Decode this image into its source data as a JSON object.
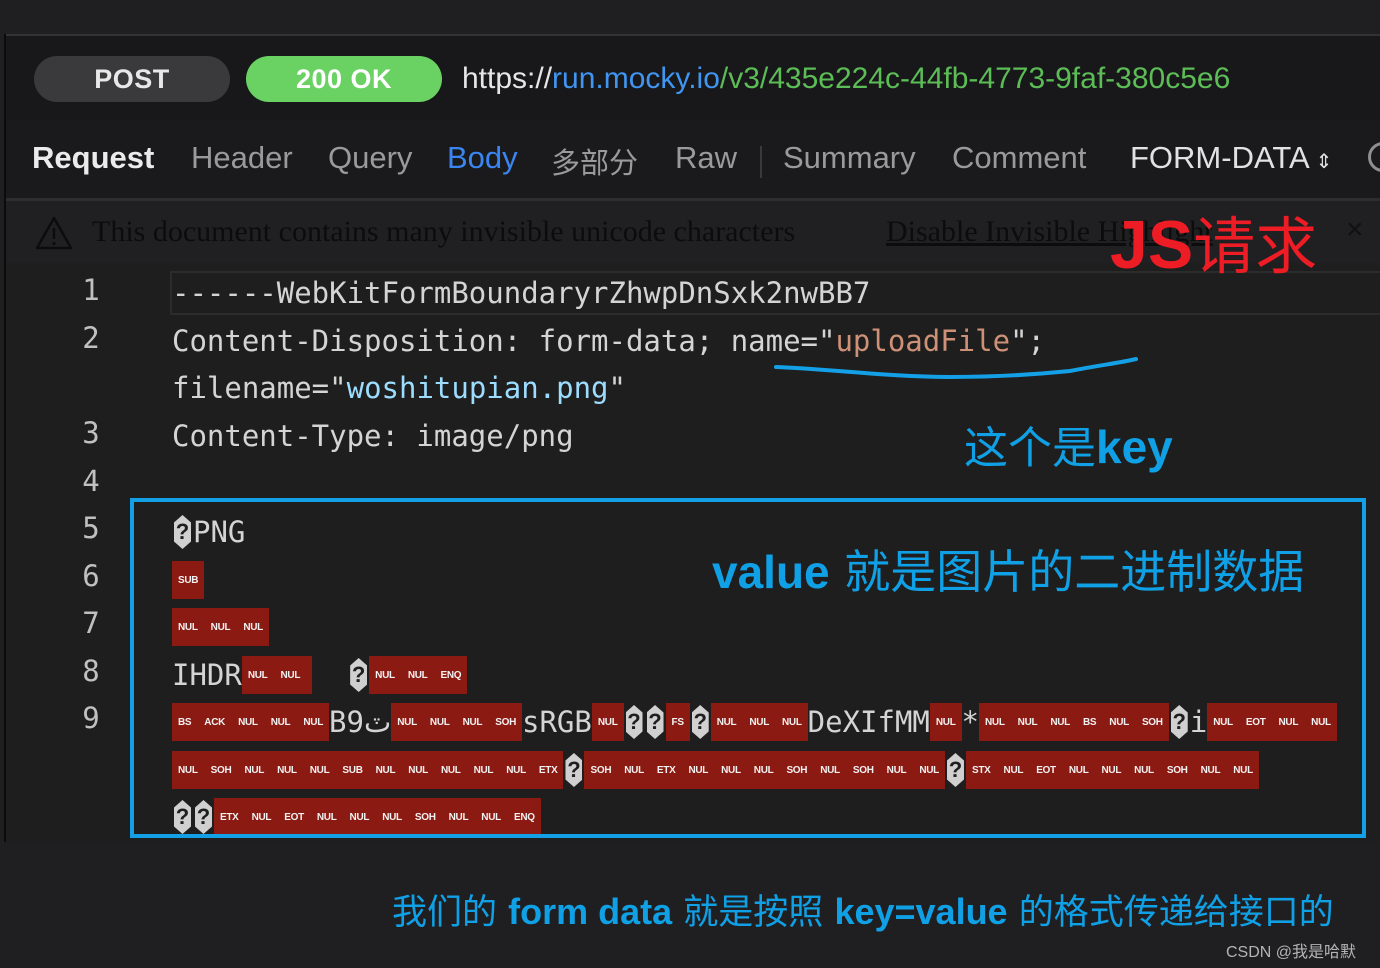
{
  "request_bar": {
    "method": "POST",
    "status": "200 OK",
    "url": {
      "scheme": "https://",
      "host": "run.mocky.io",
      "path": "/v3/435e224c-44fb-4773-9faf-380c5e6"
    },
    "colors": {
      "status_bg": "#6ad163",
      "host": "#3f95f0",
      "path": "#5cbd56"
    }
  },
  "tabs": {
    "title": "Request",
    "items": [
      "Header",
      "Query",
      "Body",
      "多部分",
      "Raw",
      "Summary",
      "Comment"
    ],
    "active": "Body",
    "format_select": "FORM-DATA",
    "format_icon": "up-down-chevron-icon",
    "more_icon": "more-icon"
  },
  "warning": {
    "icon": "warning-triangle-icon",
    "message": "This document contains many invisible unicode characters",
    "action": "Disable Invisible Highlight",
    "close": "×"
  },
  "editor": {
    "line_numbers": [
      "1",
      "2",
      "",
      "3",
      "4",
      "5",
      "6",
      "7",
      "8",
      "9"
    ],
    "line1": "------WebKitFormBoundaryrZhwpDnSxk2nwBB7",
    "line2_prefix": "Content-Disposition: form-data; name=\"",
    "line2_name": "uploadFile",
    "line2_suffix": "\";",
    "line2b_prefix": "filename=\"",
    "line2b_filename": "woshitupian.png",
    "line2b_suffix": "\"",
    "line3": "Content-Type: image/png",
    "line5_text": "PNG",
    "line6_ctrl": [
      "SUB"
    ],
    "line7_ctrl": [
      "NUL",
      "NUL",
      "NUL"
    ],
    "line8": {
      "text": "IHDR",
      "ctrl_a": [
        "NUL",
        "NUL"
      ],
      "ctrl_b": [
        "NUL",
        "NUL",
        "ENQ"
      ]
    },
    "line9": {
      "ctrl_1": [
        "BS",
        "ACK",
        "NUL",
        "NUL",
        "NUL"
      ],
      "text_1": "B9ٽ",
      "ctrl_2": [
        "NUL",
        "NUL",
        "NUL",
        "SOH"
      ],
      "text_2": "sRGB",
      "ctrl_3": [
        "NUL"
      ],
      "ctrl_4": [
        "FS"
      ],
      "ctrl_5": [
        "NUL",
        "NUL",
        "NUL"
      ],
      "text_3": "DeXIfMM",
      "ctrl_6": [
        "NUL"
      ],
      "text_4": "*",
      "ctrl_7": [
        "NUL",
        "NUL",
        "NUL",
        "BS",
        "NUL",
        "SOH"
      ],
      "text_5": "i",
      "ctrl_8": [
        "NUL",
        "EOT",
        "NUL",
        "NUL"
      ]
    },
    "line9_wrap1": {
      "ctrl_1": [
        "NUL",
        "SOH",
        "NUL",
        "NUL",
        "NUL",
        "SUB",
        "NUL",
        "NUL",
        "NUL",
        "NUL",
        "NUL",
        "ETX"
      ],
      "ctrl_2": [
        "SOH",
        "NUL",
        "ETX",
        "NUL",
        "NUL",
        "NUL",
        "SOH",
        "NUL",
        "SOH",
        "NUL",
        "NUL"
      ],
      "ctrl_3": [
        "STX",
        "NUL",
        "EOT",
        "NUL",
        "NUL",
        "NUL",
        "SOH",
        "NUL",
        "NUL"
      ]
    },
    "line9_wrap2": {
      "ctrl_1": [
        "ETX",
        "NUL",
        "EOT",
        "NUL",
        "NUL",
        "NUL",
        "SOH",
        "NUL",
        "NUL",
        "ENQ"
      ]
    },
    "unknown_glyph": "?"
  },
  "annotations": {
    "js_request": {
      "latin": "JS",
      "cn": "请求",
      "color": "#ee1c24"
    },
    "key_note": {
      "cn": "这个是",
      "latin": "key",
      "color": "#10a0e6"
    },
    "value_note": {
      "latin": "value",
      "cn": " 就是图片的二进制数据",
      "color": "#10a0e6"
    },
    "bottom_note": {
      "part1": "我们的 ",
      "part2": "form data",
      "part3": " 就是按照 ",
      "part4": "key=value",
      "part5": " 的格式传递给接口的"
    },
    "watermark": "CSDN @我是哈默"
  }
}
